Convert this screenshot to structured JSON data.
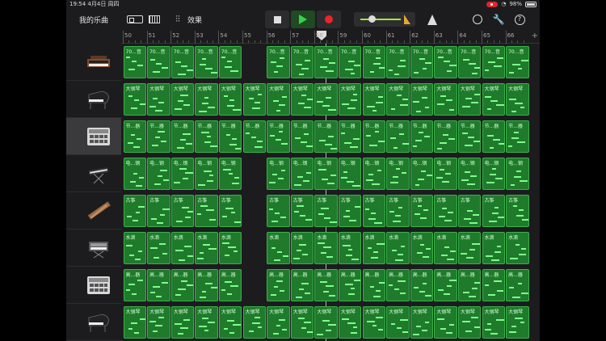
{
  "statusbar": {
    "time": "19:54",
    "date": "4月4日 周四",
    "battery": "98%"
  },
  "toolbar": {
    "my_songs": "我的乐曲",
    "fx_label": "效果",
    "mixer_glyph": "⫶⫶",
    "settings_glyph": "🔧",
    "help_glyph": "?"
  },
  "ruler": {
    "bars": [
      "50",
      "51",
      "52",
      "53",
      "54",
      "55",
      "56",
      "57",
      "58",
      "59",
      "60",
      "61",
      "62",
      "63",
      "64",
      "65",
      "66"
    ],
    "plus": "+"
  },
  "tracks": [
    {
      "name": "synth",
      "region_label": "70...音",
      "gap": [
        5
      ]
    },
    {
      "name": "grand-piano",
      "region_label": "大钢琴",
      "gap": []
    },
    {
      "name": "drum-machine",
      "region_label": "节...器",
      "gap": []
    },
    {
      "name": "keyboard",
      "region_label": "电...钢",
      "gap": [
        5
      ]
    },
    {
      "name": "guzheng",
      "region_label": "古筝",
      "gap": [
        5
      ]
    },
    {
      "name": "synth-pad",
      "region_label": "水滴",
      "gap": [
        5
      ]
    },
    {
      "name": "beat-machine",
      "region_label": "高...器",
      "gap": [
        5
      ]
    },
    {
      "name": "grand-piano-2",
      "region_label": "大钢琴",
      "gap": []
    }
  ],
  "colors": {
    "region": "#1f7a2c",
    "region_border": "#38b34a",
    "note": "#7dff8a",
    "play": "#37d447",
    "record": "#e8262c"
  }
}
